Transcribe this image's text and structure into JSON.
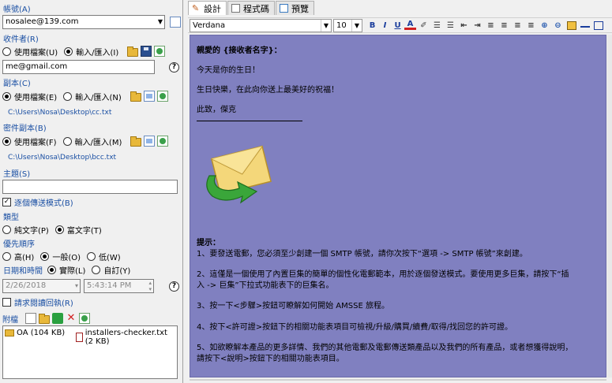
{
  "left": {
    "account": {
      "label": "帳號(A)",
      "value": "nosalee@139.com"
    },
    "recipient": {
      "label": "收件者(R)",
      "use_file": "使用檔案(U)",
      "input_import": "輸入/匯入(I)",
      "value": "me@gmail.com"
    },
    "cc": {
      "label": "副本(C)",
      "use_file": "使用檔案(E)",
      "input_import": "輸入/匯入(N)",
      "path": "C:\\Users\\Nosa\\Desktop\\cc.txt"
    },
    "bcc": {
      "label": "密件副本(B)",
      "use_file": "使用檔案(F)",
      "input_import": "輸入/匯入(M)",
      "path": "C:\\Users\\Nosa\\Desktop\\bcc.txt"
    },
    "subject": {
      "label": "主題(S)",
      "value": ""
    },
    "one_by_one": "逐個傳送模式(B)",
    "type": {
      "label": "類型",
      "plain": "純文字(P)",
      "rich": "富文字(T)"
    },
    "priority": {
      "label": "優先順序",
      "high": "高(H)",
      "normal": "一般(O)",
      "low": "低(W)"
    },
    "datetime": {
      "label": "日期和時間",
      "actual": "實際(L)",
      "custom": "自訂(Y)",
      "date": "2/26/2018",
      "time": "5:43:14 PM"
    },
    "read_receipt": "請求閱讀回執(R)",
    "attachments": {
      "label": "附檔",
      "items": [
        {
          "name": "OA (104 KB)",
          "icon": "folder-icon"
        },
        {
          "name": "installers-checker.txt (2 KB)",
          "icon": "text-file-icon"
        }
      ]
    },
    "help_glyph": "?"
  },
  "right": {
    "tabs": [
      {
        "label": "設計",
        "active": true
      },
      {
        "label": "程式碼",
        "active": false
      },
      {
        "label": "預覽",
        "active": false
      }
    ],
    "font": "Verdana",
    "size": "10",
    "format_buttons": [
      "B",
      "I",
      "U",
      "A"
    ],
    "editor": {
      "greeting": "親愛的 {接收者名字}：",
      "line1": "今天是你的生日！",
      "line2": "生日快樂，在此向你送上最美好的祝福！",
      "closing": "此致，傑克",
      "hint_title": "提示：",
      "hint1": "1、要發送電郵，您必須至少創建一個 SMTP 帳號，請你次按下“選項 -> SMTP 帳號”來創建。",
      "hint2a": "2、這僅是一個使用了內置巨集的簡單的個性化電郵範本，用於逐個發送模式。要使用更多巨集，請按下“插",
      "hint2b": "入 -> 巨集”下拉式功能表下的巨集名。",
      "hint3": "3、按一下<步驟>按鈕可瞭解如何開始 AMSSE 旅程。",
      "hint4": "4、按下<許可證>按鈕下的相關功能表項目可檢視/升級/購買/續費/取得/找回您的許可證。",
      "hint5a": "5、如欲瞭解本產品的更多詳情、我們的其他電郵及電郵傳送類產品以及我們的所有產品，或者想獲得說明，",
      "hint5b": "請按下<說明>按鈕下的相關功能表項目。"
    },
    "editor_bg": "#8080c0"
  }
}
